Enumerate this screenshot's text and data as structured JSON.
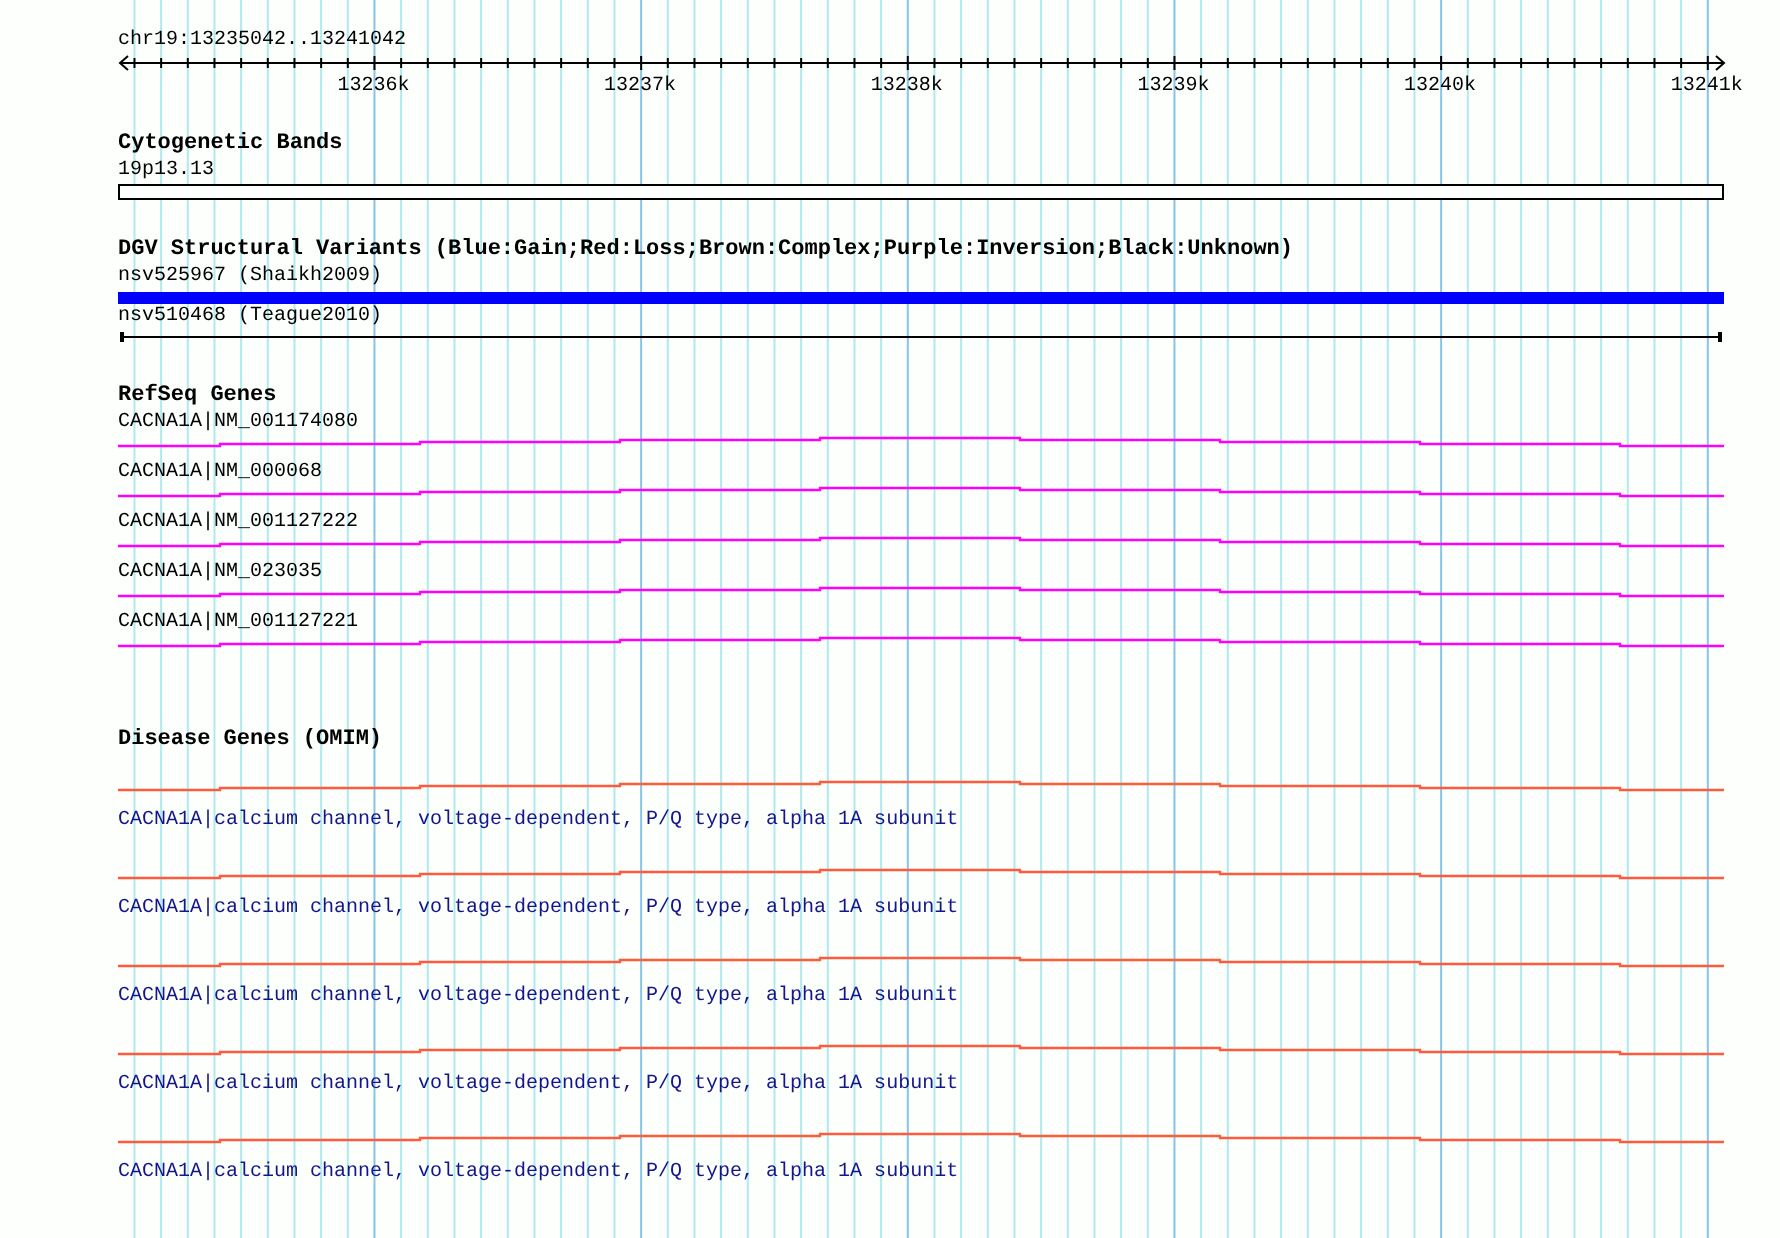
{
  "ruler": {
    "location": "chr19:13235042..13241042",
    "ticks": [
      "13236k",
      "13237k",
      "13238k",
      "13239k",
      "13240k",
      "13241k"
    ]
  },
  "tracks": [
    {
      "kind": "band",
      "title": "Cytogenetic Bands",
      "features": [
        {
          "label": "19p13.13"
        }
      ]
    },
    {
      "kind": "variants",
      "title": "DGV Structural Variants (Blue:Gain;Red:Loss;Brown:Complex;Purple:Inversion;Black:Unknown)",
      "features": [
        {
          "label": "nsv525967 (Shaikh2009)",
          "kind": "bar",
          "color": "#0000ff"
        },
        {
          "label": "nsv510468 (Teague2010)",
          "kind": "line",
          "color": "#000000"
        }
      ]
    },
    {
      "kind": "genes",
      "title": "RefSeq Genes",
      "features": [
        {
          "label": "CACNA1A|NM_001174080"
        },
        {
          "label": "CACNA1A|NM_000068"
        },
        {
          "label": "CACNA1A|NM_001127222"
        },
        {
          "label": "CACNA1A|NM_023035"
        },
        {
          "label": "CACNA1A|NM_001127221"
        }
      ]
    },
    {
      "kind": "disease",
      "title": "Disease Genes (OMIM)",
      "features": [
        {
          "label": "CACNA1A|calcium channel, voltage-dependent, P/Q type, alpha 1A subunit"
        },
        {
          "label": "CACNA1A|calcium channel, voltage-dependent, P/Q type, alpha 1A subunit"
        },
        {
          "label": "CACNA1A|calcium channel, voltage-dependent, P/Q type, alpha 1A subunit"
        },
        {
          "label": "CACNA1A|calcium channel, voltage-dependent, P/Q type, alpha 1A subunit"
        },
        {
          "label": "CACNA1A|calcium channel, voltage-dependent, P/Q type, alpha 1A subunit"
        }
      ]
    }
  ]
}
